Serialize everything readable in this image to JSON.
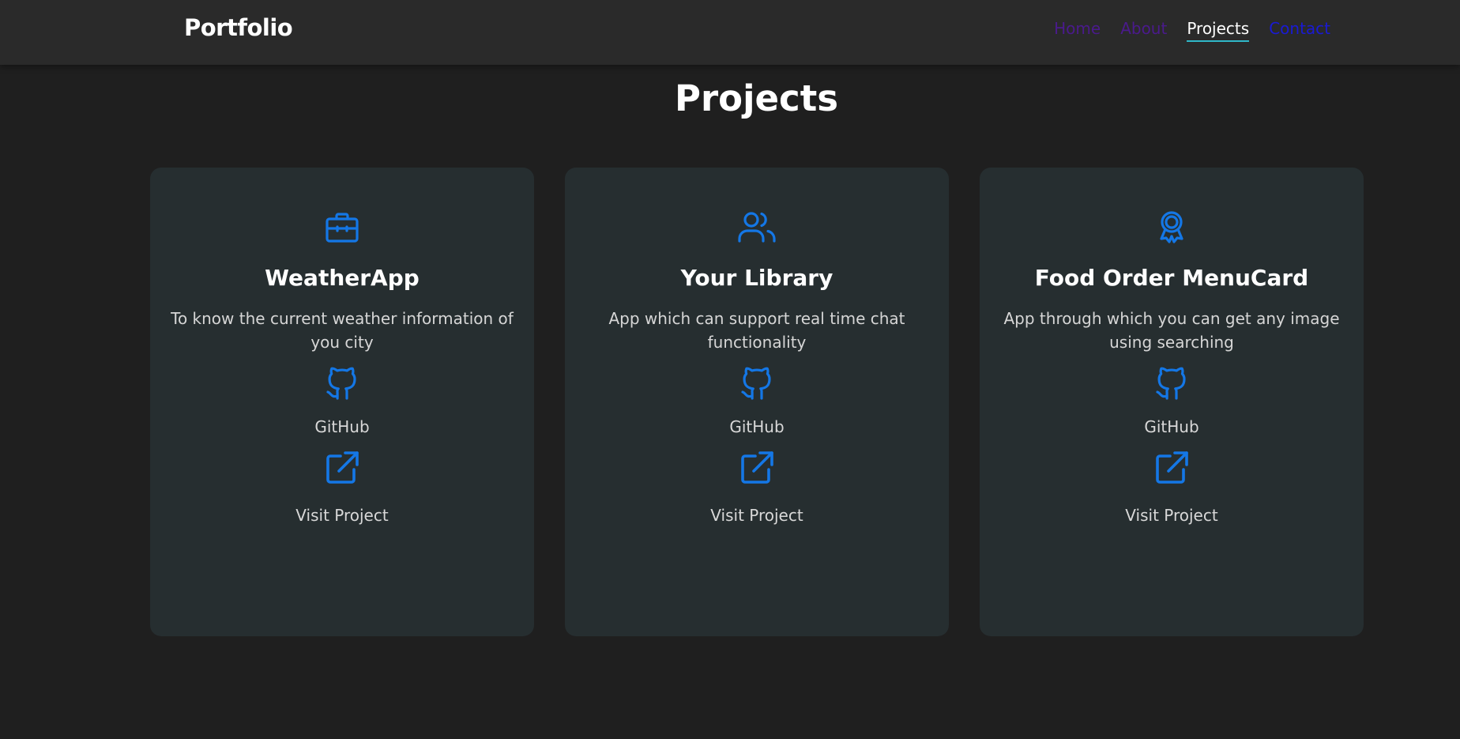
{
  "brand": "Portfolio",
  "nav": [
    {
      "label": "Home",
      "color": "#4a1a8c",
      "active": false
    },
    {
      "label": "About",
      "color": "#4a1a8c",
      "active": false
    },
    {
      "label": "Projects",
      "color": "#ffffff",
      "active": true
    },
    {
      "label": "Contact",
      "color": "#1a1ad4",
      "active": false
    }
  ],
  "page_title": "Projects",
  "accent_color": "#1477e6",
  "projects": [
    {
      "icon": "briefcase-icon",
      "title": "WeatherApp",
      "description": "To know the current weather information of you city",
      "github_label": "GitHub",
      "visit_label": "Visit Project"
    },
    {
      "icon": "users-icon",
      "title": "Your Library",
      "description": "App which can support real time chat functionality",
      "github_label": "GitHub",
      "visit_label": "Visit Project"
    },
    {
      "icon": "award-icon",
      "title": "Food Order MenuCard",
      "description": "App through which you can get any image using searching",
      "github_label": "GitHub",
      "visit_label": "Visit Project"
    }
  ]
}
